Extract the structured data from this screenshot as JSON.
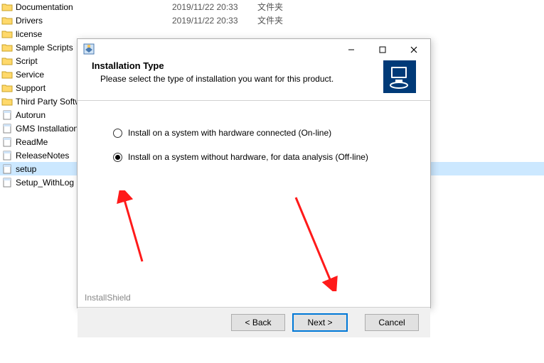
{
  "explorer": {
    "items": [
      {
        "name": "Documentation",
        "date": "2019/11/22 20:33",
        "type": "文件夹",
        "kind": "folder"
      },
      {
        "name": "Drivers",
        "date": "2019/11/22 20:33",
        "type": "文件夹",
        "kind": "folder"
      },
      {
        "name": "license",
        "date": "",
        "type": "",
        "kind": "folder"
      },
      {
        "name": "Sample Scripts",
        "date": "",
        "type": "",
        "kind": "folder"
      },
      {
        "name": "Script",
        "date": "",
        "type": "",
        "kind": "folder"
      },
      {
        "name": "Service",
        "date": "",
        "type": "",
        "kind": "folder"
      },
      {
        "name": "Support",
        "date": "",
        "type": "",
        "kind": "folder"
      },
      {
        "name": "Third Party Softw",
        "date": "",
        "type": "",
        "kind": "folder"
      },
      {
        "name": "Autorun",
        "date": "",
        "type": "",
        "kind": "file"
      },
      {
        "name": "GMS Installation",
        "date": "",
        "type": "",
        "kind": "file"
      },
      {
        "name": "ReadMe",
        "date": "",
        "type": "",
        "kind": "file"
      },
      {
        "name": "ReleaseNotes",
        "date": "",
        "type": "",
        "kind": "file"
      },
      {
        "name": "setup",
        "date": "",
        "type": "",
        "kind": "file",
        "selected": true
      },
      {
        "name": "Setup_WithLog",
        "date": "",
        "type": "",
        "kind": "file"
      }
    ]
  },
  "dialog": {
    "title": "Installation Type",
    "subtitle": "Please select the type of installation you want for this product.",
    "option1": "Install on a system with hardware connected (On-line)",
    "option2": "Install on a system without hardware, for data analysis (Off-line)",
    "selected_option": 2,
    "brand": "InstallShield",
    "buttons": {
      "back": "< Back",
      "next": "Next >",
      "cancel": "Cancel"
    }
  }
}
